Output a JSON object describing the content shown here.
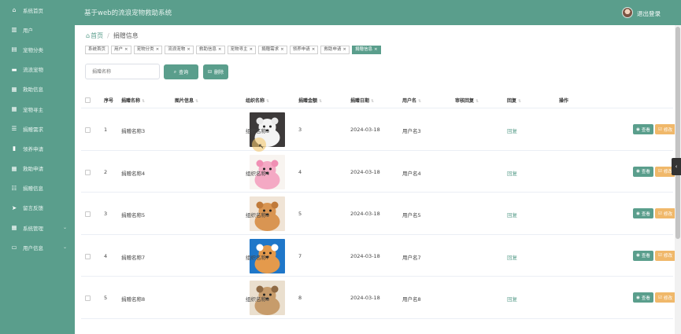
{
  "header": {
    "title": "基于web的流浪宠物救助系统",
    "logout": "退出登录"
  },
  "sidebar": {
    "items": [
      {
        "label": "系统首页",
        "icon": "home-icon",
        "glyph": "⌂"
      },
      {
        "label": "用户",
        "icon": "users-icon",
        "glyph": "▥"
      },
      {
        "label": "宠物分类",
        "icon": "tag-icon",
        "glyph": "▤"
      },
      {
        "label": "流浪宠物",
        "icon": "paw-icon",
        "glyph": "▬"
      },
      {
        "label": "救助信息",
        "icon": "rescue-icon",
        "glyph": "▦"
      },
      {
        "label": "宠物寻主",
        "icon": "search-pet-icon",
        "glyph": "▦"
      },
      {
        "label": "捐赠需求",
        "icon": "list-icon",
        "glyph": "☰"
      },
      {
        "label": "领养申请",
        "icon": "document-icon",
        "glyph": "▮"
      },
      {
        "label": "救助申请",
        "icon": "grid-icon",
        "glyph": "▦"
      },
      {
        "label": "捐赠信息",
        "icon": "sliders-icon",
        "glyph": "☷"
      },
      {
        "label": "留言反馈",
        "icon": "send-icon",
        "glyph": "➤"
      },
      {
        "label": "系统管理",
        "icon": "settings-icon",
        "glyph": "▦",
        "caret": "⌄"
      },
      {
        "label": "用户信息",
        "icon": "calendar-icon",
        "glyph": "▭",
        "caret": "⌄"
      }
    ]
  },
  "breadcrumb": {
    "home": "首页",
    "separator": "/",
    "current": "捐赠信息"
  },
  "tabs": [
    {
      "label": "系统首页",
      "closable": false
    },
    {
      "label": "用户",
      "closable": true
    },
    {
      "label": "宠物分类",
      "closable": true
    },
    {
      "label": "流浪宠物",
      "closable": true
    },
    {
      "label": "救助信息",
      "closable": true
    },
    {
      "label": "宠物寻主",
      "closable": true
    },
    {
      "label": "捐赠需求",
      "closable": true
    },
    {
      "label": "领养申请",
      "closable": true
    },
    {
      "label": "救助申请",
      "closable": true
    },
    {
      "label": "捐赠信息",
      "closable": true,
      "active": true
    }
  ],
  "tab_close": "×",
  "toolbar": {
    "search_placeholder": "捐赠名称",
    "search_button": "查询",
    "search_glyph": "⌕",
    "delete_button": "删除",
    "delete_glyph": "⊟"
  },
  "table": {
    "headers": {
      "index": "序号",
      "donation_name": "捐赠名称",
      "image": "图片信息",
      "org": "组织名称",
      "amount": "捐赠金额",
      "date": "捐赠日期",
      "user": "用户名",
      "review_reply": "审核回复",
      "reply": "回复",
      "actions": "操作"
    },
    "sort_glyph": "⇅",
    "actions": {
      "view": "查看",
      "edit": "修改",
      "delete": "删除",
      "view_glyph": "◉",
      "edit_glyph": "☑",
      "delete_glyph": "⊗"
    },
    "rows": [
      {
        "index": "1",
        "donation_name": "捐赠名称3",
        "org": "组织名称3",
        "amount": "3",
        "date": "2024-03-18",
        "user": "用户名3",
        "review_reply": "",
        "reply": "回复",
        "pet": "white-pomeranian"
      },
      {
        "index": "2",
        "donation_name": "捐赠名称4",
        "org": "组织名称4",
        "amount": "4",
        "date": "2024-03-18",
        "user": "用户名4",
        "review_reply": "",
        "reply": "回复",
        "pet": "pink-poodle"
      },
      {
        "index": "3",
        "donation_name": "捐赠名称5",
        "org": "组织名称5",
        "amount": "5",
        "date": "2024-03-18",
        "user": "用户名5",
        "review_reply": "",
        "reply": "回复",
        "pet": "orange-pomeranian"
      },
      {
        "index": "4",
        "donation_name": "捐赠名称7",
        "org": "组织名称7",
        "amount": "7",
        "date": "2024-03-18",
        "user": "用户名7",
        "review_reply": "",
        "reply": "回复",
        "pet": "corgi"
      },
      {
        "index": "5",
        "donation_name": "捐赠名称8",
        "org": "组织名称8",
        "amount": "8",
        "date": "2024-03-18",
        "user": "用户名8",
        "review_reply": "",
        "reply": "回复",
        "pet": "french-bulldog"
      }
    ]
  },
  "colors": {
    "primary": "#5a9e8c",
    "warning": "#f0b86a",
    "danger": "#f18c8c"
  },
  "collapse_glyph": "‹"
}
